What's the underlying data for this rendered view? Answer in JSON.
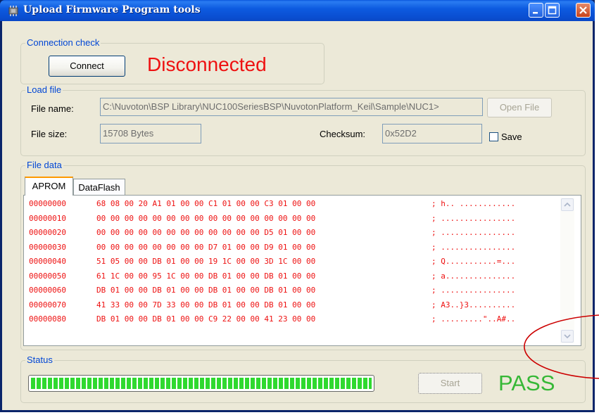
{
  "window": {
    "title": "Upload Firmware Program tools",
    "icon": "chip-icon"
  },
  "connection": {
    "group_label": "Connection check",
    "connect_label": "Connect",
    "status_text": "Disconnected",
    "status_color": "#ee1111"
  },
  "load_file": {
    "group_label": "Load file",
    "file_name_label": "File name:",
    "file_name_value": "C:\\Nuvoton\\BSP Library\\NUC100SeriesBSP\\NuvotonPlatform_Keil\\Sample\\NUC1>",
    "open_file_label": "Open File",
    "file_size_label": "File size:",
    "file_size_value": "15708 Bytes",
    "checksum_label": "Checksum:",
    "checksum_value": "0x52D2",
    "save_label": "Save",
    "save_checked": false
  },
  "file_data": {
    "group_label": "File data",
    "tabs": [
      {
        "label": "APROM",
        "active": true
      },
      {
        "label": "DataFlash",
        "active": false
      }
    ],
    "rows": [
      {
        "addr": "00000000",
        "bytes": "68 08 00 20 A1 01 00 00 C1 01 00 00 C3 01 00 00",
        "ascii": "; h.. ............"
      },
      {
        "addr": "00000010",
        "bytes": "00 00 00 00 00 00 00 00 00 00 00 00 00 00 00 00",
        "ascii": "; ................"
      },
      {
        "addr": "00000020",
        "bytes": "00 00 00 00 00 00 00 00 00 00 00 00 D5 01 00 00",
        "ascii": "; ................"
      },
      {
        "addr": "00000030",
        "bytes": "00 00 00 00 00 00 00 00 D7 01 00 00 D9 01 00 00",
        "ascii": "; ................"
      },
      {
        "addr": "00000040",
        "bytes": "51 05 00 00 DB 01 00 00 19 1C 00 00 3D 1C 00 00",
        "ascii": "; Q...........=..."
      },
      {
        "addr": "00000050",
        "bytes": "61 1C 00 00 95 1C 00 00 DB 01 00 00 DB 01 00 00",
        "ascii": "; a..............."
      },
      {
        "addr": "00000060",
        "bytes": "DB 01 00 00 DB 01 00 00 DB 01 00 00 DB 01 00 00",
        "ascii": "; ................"
      },
      {
        "addr": "00000070",
        "bytes": "41 33 00 00 7D 33 00 00 DB 01 00 00 DB 01 00 00",
        "ascii": "; A3..}3.........."
      },
      {
        "addr": "00000080",
        "bytes": "DB 01 00 00 DB 01 00 00 C9 22 00 00 41 23 00 00",
        "ascii": "; .........\"..A#.."
      }
    ],
    "text_color": "#ee1111"
  },
  "status": {
    "group_label": "Status",
    "progress": 1.0,
    "start_label": "Start",
    "result_text": "PASS",
    "result_color": "#36b836"
  },
  "annotation": {
    "type": "red-ellipse",
    "color": "#cc0000"
  }
}
